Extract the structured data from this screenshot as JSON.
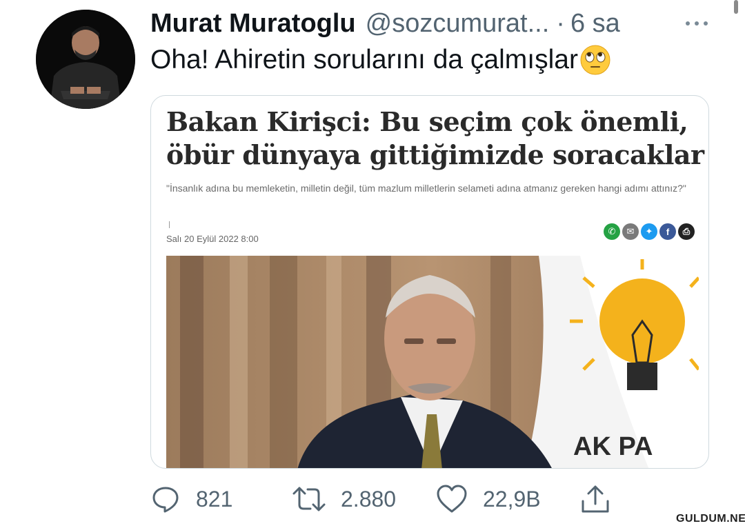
{
  "tweet": {
    "author_name": "Murat Muratoglu",
    "handle": "@sozcumurat...",
    "separator": "·",
    "time": "6 sa",
    "text": "Oha! Ahiretin sorularını da çalmışlar",
    "emoji": "face-with-rolling-eyes-icon"
  },
  "card": {
    "headline": "Bakan Kirişci: Bu seçim çok önemli, öbür dünyaya gittiğimizde soracaklar",
    "subtitle": "\"İnsanlık adına bu memleketin, milletin değil, tüm mazlum milletlerin selameti adına atmanız gereken hangi adımı attınız?\"",
    "date": "Salı 20 Eylül 2022 8:00",
    "share_icons": [
      "whatsapp-icon",
      "email-icon",
      "twitter-icon",
      "facebook-icon",
      "print-icon"
    ],
    "share_colors": [
      "#25a244",
      "#7a7a7a",
      "#1d9bf0",
      "#3b5998",
      "#222222"
    ],
    "flag_text": "AK PA"
  },
  "actions": {
    "reply_count": "821",
    "retweet_count": "2.880",
    "like_count": "22,9B"
  },
  "watermark": "GULDUM.NET",
  "colors": {
    "text_primary": "#0f1419",
    "text_secondary": "#536471",
    "border": "#cfd9de",
    "flag_yellow": "#f4b21c"
  }
}
